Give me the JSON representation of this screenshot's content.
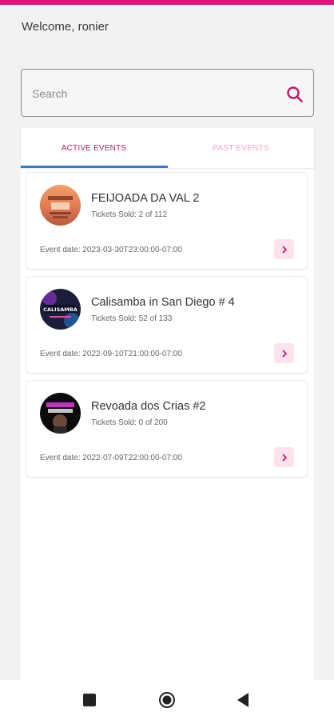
{
  "accent_color": "#e2127a",
  "header": {
    "welcome_text": "Welcome, ronier"
  },
  "search": {
    "placeholder": "Search",
    "value": "",
    "icon": "search-icon"
  },
  "tabs": [
    {
      "label": "ACTIVE EVENTS",
      "active": true
    },
    {
      "label": "PAST EVENTS",
      "active": false
    }
  ],
  "events": [
    {
      "title": "FEIJOADA DA VAL 2",
      "tickets_sold": "Tickets Sold: 2 of 112",
      "event_date": "Event date: 2023-03-30T23:00:00-07:00",
      "avatar_text": ""
    },
    {
      "title": "Calisamba in San Diego # 4",
      "tickets_sold": "Tickets Sold: 52 of 133",
      "event_date": "Event date: 2022-09-10T21:00:00-07:00",
      "avatar_text": "CALISAMBA"
    },
    {
      "title": "Revoada dos Crias #2",
      "tickets_sold": "Tickets Sold: 0 of 200",
      "event_date": "Event date: 2022-07-09T22:00:00-07:00",
      "avatar_text": ""
    }
  ],
  "system_nav": {
    "buttons": [
      "recents-icon",
      "home-icon",
      "back-icon"
    ]
  }
}
